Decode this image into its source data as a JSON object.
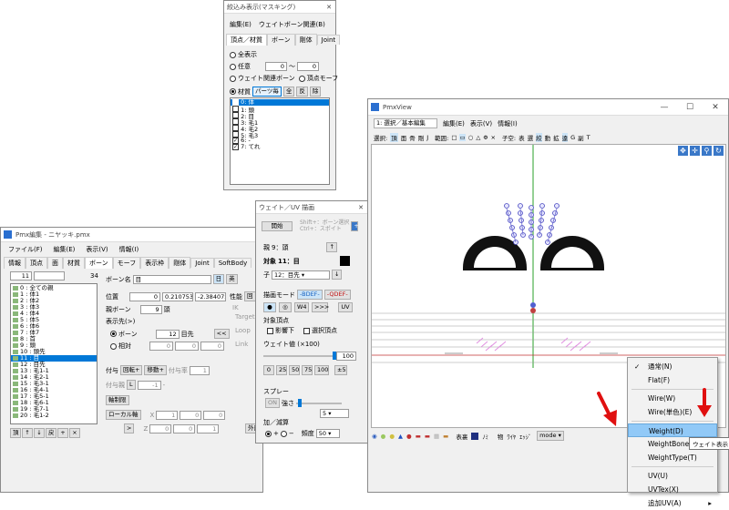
{
  "masking": {
    "title": "絞込み表示(マスキング)",
    "menus": [
      "編集(E)",
      "ウェイトボーン関連(B)"
    ],
    "tabs": [
      "頂点／材質",
      "ボーン",
      "剛体",
      "Joint"
    ],
    "radios": [
      "全表示",
      "任意",
      "ウェイト関連ボーン",
      "材質"
    ],
    "vertex_morph": "頂点モーフ",
    "range_from": "0",
    "range_sep": "〜",
    "range_to": "0",
    "range_btn": "…",
    "mat_buttons": [
      "パーツ毎",
      "全",
      "反",
      "除"
    ],
    "items": [
      "0: 体",
      "1: 頭",
      "2: 目",
      "3: 毛1",
      "4: 毛2",
      "5: 毛3",
      "6: -",
      "7: てれ"
    ]
  },
  "pmx": {
    "title": "Pmx編集 - ニヤッキ.pmx",
    "menus": [
      "ファイル(F)",
      "編集(E)",
      "表示(V)",
      "情報(I)"
    ],
    "tabs": [
      "情報",
      "頂点",
      "面",
      "材質",
      "ボーン",
      "モーフ",
      "表示枠",
      "剛体",
      "Joint",
      "SoftBody"
    ],
    "index": "11",
    "count": "34",
    "bones": [
      "0 : 全ての親",
      "1 : 体1",
      "2 : 体2",
      "3 : 体3",
      "4 : 体4",
      "5 : 体5",
      "6 : 体6",
      "7 : 体7",
      "8 : 首",
      "9 : 頭",
      "10 : 頭先",
      "11 : 目",
      "12 : 目先",
      "13 : 毛1-1",
      "14 : 毛2-1",
      "15 : 毛3-1",
      "16 : 毛4-1",
      "17 : 毛5-1",
      "18 : 毛6-1",
      "19 : 毛7-1",
      "20 : 毛1-2"
    ],
    "bone_name_label": "ボーン名",
    "bone_name": "目",
    "jp": "日",
    "en": "英",
    "pos_label": "位置",
    "pos": [
      "0",
      "0.2107537",
      "-2.384075"
    ],
    "perf_label": "性能",
    "perf_btn": "回",
    "parent_label": "親ボーン",
    "parent_idx": "9",
    "parent_name": "頭",
    "target_label": "表示先(>)",
    "bone_radio": "ボーン",
    "target_idx": "12",
    "target_name": "目先",
    "nav": "<<",
    "rel_radio": "相対",
    "rel": [
      "0",
      "0",
      "0"
    ],
    "grant_label": "付与",
    "grant_rot": "回転+",
    "grant_move": "移動+",
    "grant_rate_label": "付与率",
    "grant_rate": "1",
    "grant_parent_label": "付与親",
    "grant_l": "L",
    "grant_idx": "-1",
    "grant_dash": "-",
    "axis_btn": "軸制限",
    "local_btn": "ローカル軸",
    "xlbl": "X",
    "zlbl": "Z",
    "gt": ">",
    "lx": [
      "1",
      "0",
      "0"
    ],
    "lz": [
      "0",
      "0",
      "1"
    ],
    "ik_label": "IK",
    "ik_target": "Target",
    "ik_loop": "Loop",
    "ik_link": "Link",
    "external": "外部",
    "bottom": [
      "頂",
      "↑",
      "↓",
      "戻",
      "+",
      "×"
    ]
  },
  "weight": {
    "title": "ウェイト／UV 描画",
    "start": "開始",
    "hint": "Shift+：ボーン選択\nCtrl+：スポイト",
    "parent_label": "親",
    "parent": "9：頭",
    "target_label": "対象",
    "target": "11：目",
    "child_label": "子",
    "child": "12：目先",
    "mode_label": "描画モード",
    "bdef": "-BDEF-",
    "qdef": "-QDEF-",
    "btns": [
      "●",
      "◎",
      "W4",
      ">>>",
      "UV"
    ],
    "vert_label": "対象頂点",
    "effect": "影響下",
    "selected": "選択頂点",
    "wv_label": "ウェイト値 (×100)",
    "wv": "100",
    "presets": [
      "0",
      "25",
      "50",
      "75",
      "100"
    ],
    "pm": "±5",
    "spray_label": "スプレー",
    "on": "ON",
    "strength": "強さ",
    "str_val": "5",
    "add_label": "加／減算",
    "plus": "+",
    "minus": "−",
    "freq": "頻度",
    "freq_val": "50"
  },
  "view": {
    "title": "PmxView",
    "mode_select": "1: 選択／基本編集",
    "menus": [
      "編集(E)",
      "表示(V)",
      "情報(I)"
    ],
    "sel_label": "選択:",
    "sel_items": [
      "頂",
      "面",
      "骨",
      "剛",
      "J"
    ],
    "range_label": "範囲:",
    "range_items": [
      "□",
      "▭",
      "○",
      "△",
      "Φ",
      "×"
    ],
    "axis_label": "子空:",
    "axis_items": [
      "表",
      "選",
      "絞",
      "動",
      "拡",
      "遠",
      "G",
      "副",
      "T"
    ],
    "bottom_tools": [
      "表裏",
      "ﾉﾐ",
      "物",
      "ﾜｲﾔ",
      "ｴｯｼﾞ"
    ],
    "mode_btn": "mode"
  },
  "context_menu": {
    "items": [
      "通常(N)",
      "Flat(F)",
      "Wire(W)",
      "Wire(単色)(E)",
      "Weight(D)",
      "WeightBone(B)",
      "WeightType(T)",
      "UV(U)",
      "UVTex(X)",
      "追加UV(A)"
    ],
    "tooltip": "ウェイト表示"
  },
  "colors": {
    "accent": "#0078d7",
    "highlight": "#91c9f7",
    "arrow": "#e01010",
    "bdef": "#1560c0",
    "qdef": "#c01010"
  }
}
